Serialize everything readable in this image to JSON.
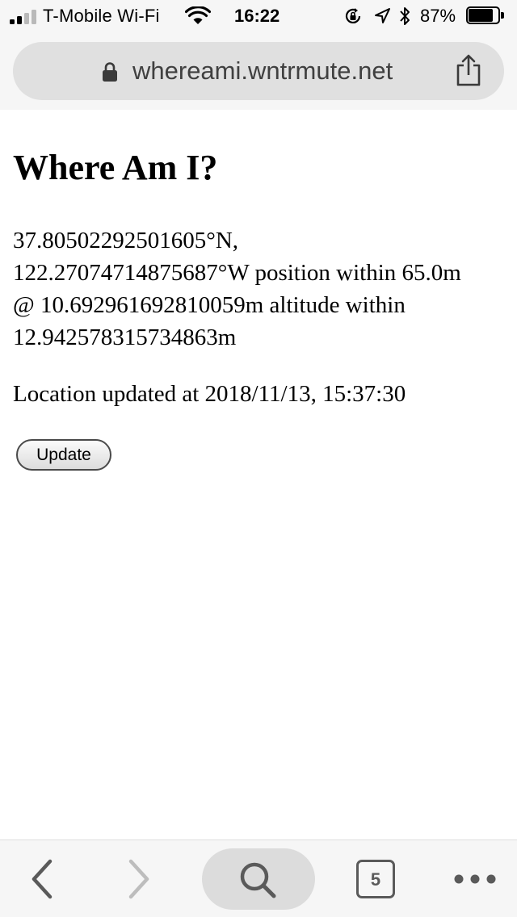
{
  "status_bar": {
    "carrier": "T-Mobile Wi-Fi",
    "time": "16:22",
    "battery_percent_text": "87%",
    "battery_level": 0.87,
    "icons": [
      "signal-icon",
      "wifi-icon",
      "rotation-lock-icon",
      "location-icon",
      "bluetooth-icon",
      "battery-icon"
    ]
  },
  "address_bar": {
    "url": "whereami.wntrmute.net",
    "icons": [
      "padlock-icon",
      "share-icon"
    ]
  },
  "page": {
    "title": "Where Am I?",
    "position_text": "37.80502292501605°N, 122.27074714875687°W position within 65.0m @ 10.692961692810059m altitude within 12.942578315734863m",
    "updated_text": "Location updated at 2018/11/13, 15:37:30",
    "update_button_label": "Update"
  },
  "toolbar": {
    "tab_count": "5",
    "icons": [
      "back-icon",
      "forward-icon",
      "search-icon",
      "tabs-icon",
      "more-icon"
    ]
  },
  "colors": {
    "chrome_background": "#f6f6f6",
    "address_bar_background": "#e0e0e0",
    "toolbar_icon": "#5a5a5a",
    "disabled_icon": "#bdbdbd"
  }
}
